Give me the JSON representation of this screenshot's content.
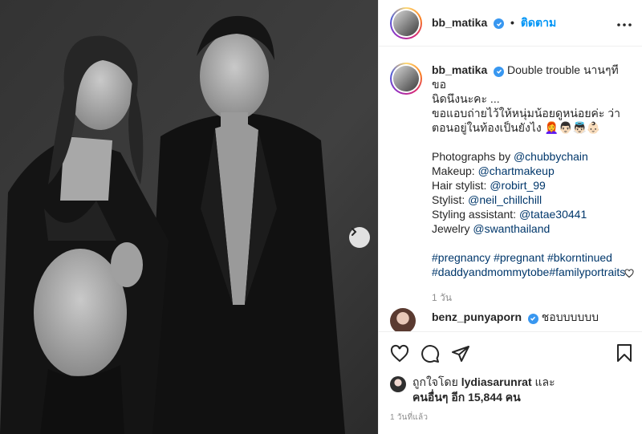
{
  "header": {
    "username": "bb_matika",
    "separator": "•",
    "follow_label": "ติดตาม"
  },
  "caption": {
    "username": "bb_matika",
    "lines": [
      "Double trouble นานๆทีขอ",
      "นิดนึงนะคะ ...",
      "ขอแอบถ่ายไว้ให้หนุ่มน้อยดูหน่อยค่ะ ว่า",
      "ตอนอยู่ในท้องเป็นยังไง 👩‍🦰👨🏻👼🏻👶🏻"
    ],
    "credits": [
      {
        "label": "Photographs by",
        "handle": "@chubbychain"
      },
      {
        "label": "Makeup:",
        "handle": "@chartmakeup"
      },
      {
        "label": "Hair stylist:",
        "handle": "@robirt_99"
      },
      {
        "label": "Stylist:",
        "handle": "@neil_chillchill"
      },
      {
        "label": "Styling assistant:",
        "handle": "@tatae30441"
      },
      {
        "label": "Jewelry",
        "handle": "@swanthailand"
      }
    ],
    "hashtags_line1": [
      "#pregnancy",
      "#pregnant",
      "#bkorntinued"
    ],
    "hashtags_line2": [
      "#daddyandmommytobe",
      "#familyportraits"
    ],
    "time_ago": "1 วัน"
  },
  "comment": {
    "username": "benz_punyaporn",
    "text": "ชอบบบบบบ"
  },
  "likes": {
    "prefix": "ถูกใจโดย",
    "user": "lydiasarunrat",
    "and": "และ",
    "others": "คนอื่นๆ อีก 15,844 คน"
  },
  "timestamp": "1 วันที่แล้ว",
  "colors": {
    "accent_blue": "#0095f6",
    "link_blue": "#00376b",
    "verified_blue": "#3897f0",
    "muted_gray": "#8e8e8e"
  },
  "icons": [
    "more-icon",
    "heart-icon",
    "comment-icon",
    "share-icon",
    "bookmark-icon",
    "verified-icon",
    "chevron-right-icon"
  ]
}
